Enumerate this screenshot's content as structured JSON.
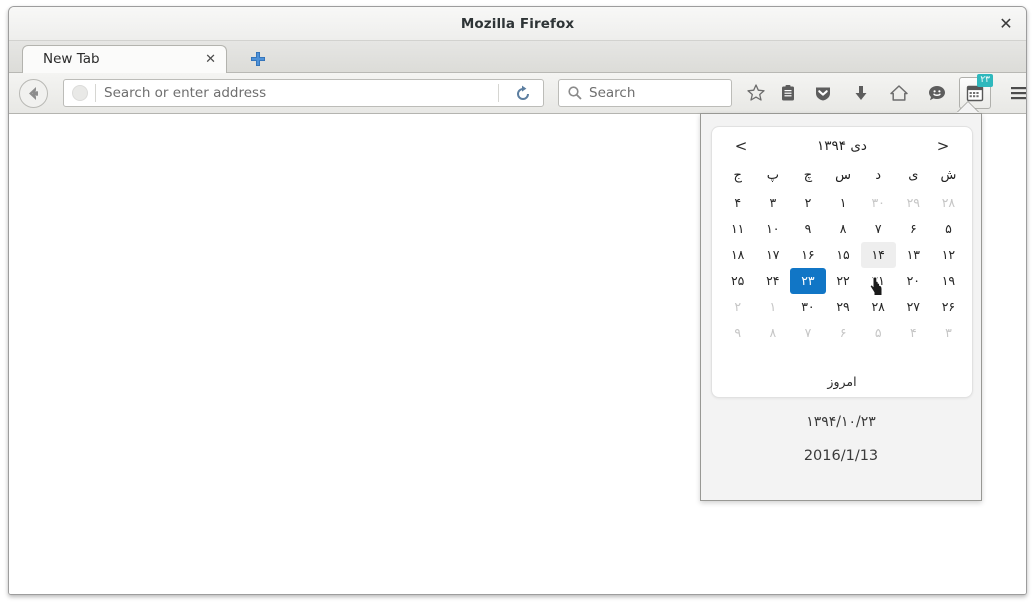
{
  "window": {
    "title": "Mozilla Firefox",
    "close_label": "✕"
  },
  "tabs": {
    "items": [
      {
        "label": "New Tab",
        "close_label": "✕"
      }
    ],
    "new_tab_label": "+"
  },
  "toolbar": {
    "back_icon": "back-arrow-icon",
    "address": {
      "placeholder": "Search or enter address",
      "value": "",
      "globe_icon": "globe-icon",
      "reload_icon": "reload-icon"
    },
    "search": {
      "placeholder": "Search",
      "value": "",
      "icon": "search-icon"
    },
    "icons": [
      {
        "name": "bookmark-star-icon",
        "label": "Bookmark"
      },
      {
        "name": "reader-clipboard-icon",
        "label": "Reader"
      },
      {
        "name": "pocket-shield-icon",
        "label": "Pocket"
      },
      {
        "name": "download-arrow-icon",
        "label": "Downloads"
      },
      {
        "name": "home-icon",
        "label": "Home"
      },
      {
        "name": "chat-smiley-icon",
        "label": "Chat"
      }
    ],
    "calendar_button": {
      "name": "calendar-toolbar-button",
      "badge": "۲۳"
    },
    "menu_icon": "hamburger-menu-icon"
  },
  "calendar": {
    "prev_label": "<",
    "next_label": ">",
    "title": "دی ۱۳۹۴",
    "weekdays": [
      "ش",
      "ی",
      "د",
      "س",
      "چ",
      "پ",
      "ج"
    ],
    "weeks": [
      [
        {
          "text": "۲۸",
          "state": "muted"
        },
        {
          "text": "۲۹",
          "state": "muted"
        },
        {
          "text": "۳۰",
          "state": "muted"
        },
        {
          "text": "۱",
          "state": "normal"
        },
        {
          "text": "۲",
          "state": "normal"
        },
        {
          "text": "۳",
          "state": "normal"
        },
        {
          "text": "۴",
          "state": "normal"
        }
      ],
      [
        {
          "text": "۵",
          "state": "normal"
        },
        {
          "text": "۶",
          "state": "normal"
        },
        {
          "text": "۷",
          "state": "normal"
        },
        {
          "text": "۸",
          "state": "normal"
        },
        {
          "text": "۹",
          "state": "normal"
        },
        {
          "text": "۱۰",
          "state": "normal"
        },
        {
          "text": "۱۱",
          "state": "normal"
        }
      ],
      [
        {
          "text": "۱۲",
          "state": "normal"
        },
        {
          "text": "۱۳",
          "state": "normal"
        },
        {
          "text": "۱۴",
          "state": "hover"
        },
        {
          "text": "۱۵",
          "state": "normal"
        },
        {
          "text": "۱۶",
          "state": "normal"
        },
        {
          "text": "۱۷",
          "state": "normal"
        },
        {
          "text": "۱۸",
          "state": "normal"
        }
      ],
      [
        {
          "text": "۱۹",
          "state": "normal"
        },
        {
          "text": "۲۰",
          "state": "normal"
        },
        {
          "text": "۲۱",
          "state": "normal"
        },
        {
          "text": "۲۲",
          "state": "normal"
        },
        {
          "text": "۲۳",
          "state": "selected"
        },
        {
          "text": "۲۴",
          "state": "normal"
        },
        {
          "text": "۲۵",
          "state": "normal"
        }
      ],
      [
        {
          "text": "۲۶",
          "state": "normal"
        },
        {
          "text": "۲۷",
          "state": "normal"
        },
        {
          "text": "۲۸",
          "state": "normal"
        },
        {
          "text": "۲۹",
          "state": "normal"
        },
        {
          "text": "۳۰",
          "state": "normal"
        },
        {
          "text": "۱",
          "state": "muted"
        },
        {
          "text": "۲",
          "state": "muted"
        }
      ],
      [
        {
          "text": "۳",
          "state": "muted"
        },
        {
          "text": "۴",
          "state": "muted"
        },
        {
          "text": "۵",
          "state": "muted"
        },
        {
          "text": "۶",
          "state": "muted"
        },
        {
          "text": "۷",
          "state": "muted"
        },
        {
          "text": "۸",
          "state": "muted"
        },
        {
          "text": "۹",
          "state": "muted"
        }
      ]
    ],
    "today_label": "امروز",
    "date_persian": "۱۳۹۴/۱۰/۲۳",
    "date_gregorian": "2016/1/13"
  },
  "colors": {
    "selected_day": "#1176c6",
    "badge": "#2fb8bd",
    "hover_day": "#eeeeee",
    "panel_bg": "#f3f3f3"
  }
}
